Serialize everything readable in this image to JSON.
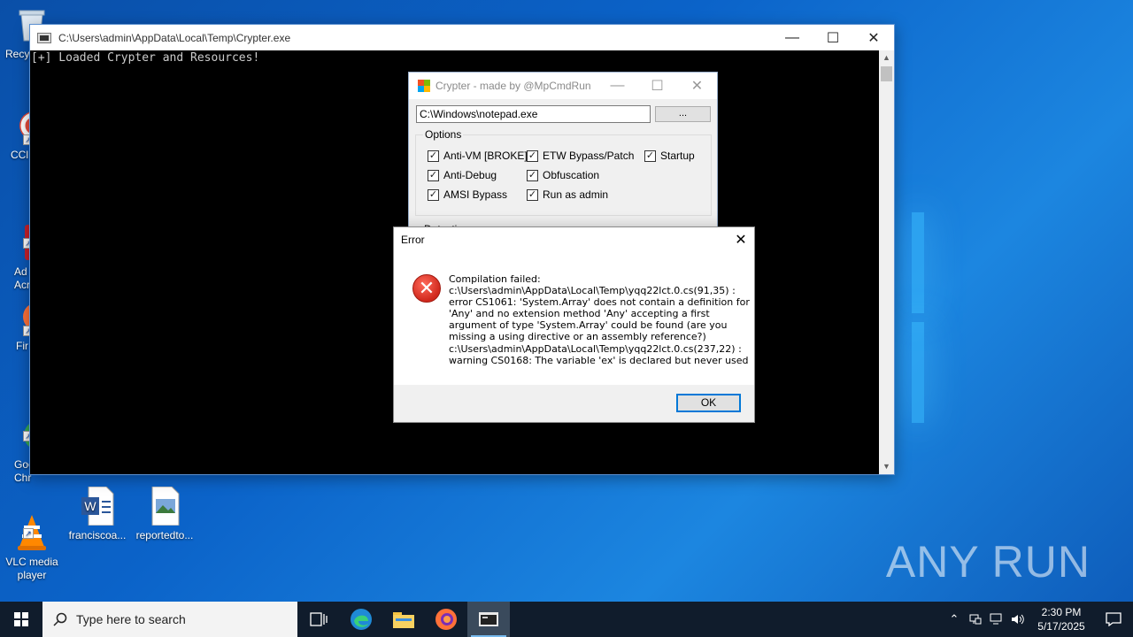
{
  "desktop": {
    "icons": [
      {
        "label": "Recy",
        "icon": "recycle-bin-icon"
      },
      {
        "label": "CCl",
        "icon": "ccleaner-icon"
      },
      {
        "label": "Ad\nAcr",
        "icon": "acrobat-icon"
      },
      {
        "label": "Fir",
        "icon": "firefox-icon"
      },
      {
        "label": "Goo\nChr",
        "icon": "chrome-icon"
      },
      {
        "label": "VLC media\nplayer",
        "icon": "vlc-icon"
      },
      {
        "label": "franciscoa...",
        "icon": "word-doc-icon"
      },
      {
        "label": "reportedto...",
        "icon": "image-file-icon"
      }
    ],
    "watermark": "ANY RUN"
  },
  "console": {
    "title": "C:\\Users\\admin\\AppData\\Local\\Temp\\Crypter.exe",
    "output": "[+] Loaded Crypter and Resources!",
    "minimize": "—",
    "maximize": "☐",
    "close": "✕"
  },
  "crypter": {
    "title": "Crypter - made by @MpCmdRun",
    "path_value": "C:\\Windows\\notepad.exe",
    "browse_label": "...",
    "options_label": "Options",
    "options": [
      {
        "label": "Anti-VM [BROKE]",
        "checked": true
      },
      {
        "label": "ETW Bypass/Patch",
        "checked": true
      },
      {
        "label": "Startup",
        "checked": true
      },
      {
        "label": "Anti-Debug",
        "checked": true
      },
      {
        "label": "Obfuscation",
        "checked": true
      },
      {
        "label": "AMSI Bypass",
        "checked": true
      },
      {
        "label": "Run as admin",
        "checked": true
      }
    ],
    "detection_label": "Detection",
    "minimize": "—",
    "maximize": "☐",
    "close": "✕"
  },
  "error_dialog": {
    "title": "Error",
    "close": "✕",
    "icon_glyph": "✕",
    "message_lines": [
      "Compilation failed:",
      "c:\\Users\\admin\\AppData\\Local\\Temp\\yqq22lct.0.cs(91,35) :",
      "error CS1061: 'System.Array' does not contain a definition for",
      "'Any' and no extension method 'Any' accepting a first",
      "argument of type 'System.Array' could be found (are you",
      "missing a using directive or an assembly reference?)",
      "c:\\Users\\admin\\AppData\\Local\\Temp\\yqq22lct.0.cs(237,22) :",
      "warning CS0168: The variable 'ex' is declared but never used"
    ],
    "ok_label": "OK"
  },
  "taskbar": {
    "search_placeholder": "Type here to search",
    "time": "2:30 PM",
    "date": "5/17/2025"
  }
}
